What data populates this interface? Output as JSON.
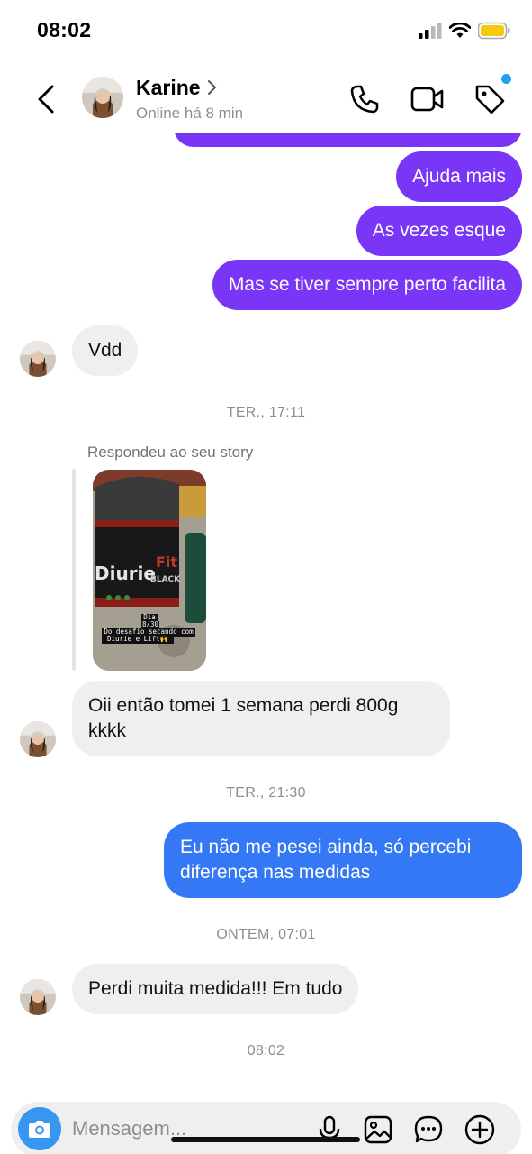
{
  "status_bar": {
    "time": "08:02"
  },
  "header": {
    "contact_name": "Karine",
    "contact_status": "Online há 8 min"
  },
  "messages": {
    "out_1": "Ajuda mais",
    "out_2": "As vezes esque",
    "out_3": "Mas se tiver sempre perto facilita",
    "in_1": "Vdd",
    "stamp_1": "TER., 17:11",
    "reply_label": "Respondeu ao seu story",
    "story": {
      "brand_main": "Diurie",
      "brand_fit": "Fit",
      "brand_sub": "BLACK",
      "caption_line_1": "Dia",
      "caption_line_2": "8/30",
      "caption_line_3": "Do desafio secando com",
      "caption_line_4": "Diurie e Lift🙌"
    },
    "in_2": "Oii então tomei 1 semana perdi 800g kkkk",
    "stamp_2": "TER., 21:30",
    "out_4": "Eu não me pesei ainda, só percebi diferença nas medidas",
    "stamp_3": "ONTEM, 07:01",
    "in_3": "Perdi muita medida!!! Em tudo",
    "stamp_4": "08:02"
  },
  "composer": {
    "placeholder": "Mensagem..."
  },
  "colors": {
    "purple": "#7a36f6",
    "blue": "#3478f6",
    "incoming": "#efefef",
    "camera": "#3797f0",
    "badge": "#1ea1f2"
  },
  "icons": [
    "back-arrow-icon",
    "chevron-right-icon",
    "phone-icon",
    "video-camera-icon",
    "tag-icon",
    "camera-icon",
    "microphone-icon",
    "gallery-icon",
    "sticker-chat-icon",
    "plus-icon",
    "signal-icon",
    "wifi-icon",
    "battery-icon"
  ]
}
